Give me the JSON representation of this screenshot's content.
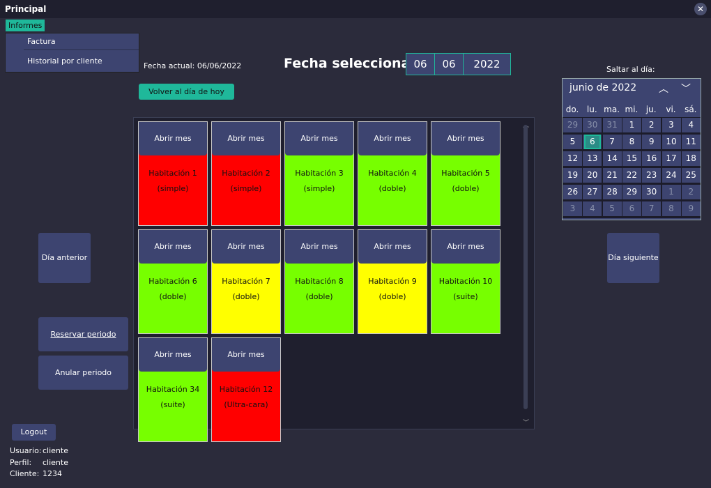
{
  "window": {
    "title": "Principal",
    "close_icon": "close-icon"
  },
  "menu": {
    "informes": "Informes",
    "items": [
      "Factura",
      "Historial por cliente"
    ]
  },
  "header": {
    "fecha_actual": "Fecha actual: 06/06/2022",
    "fecha_seleccionada_label": "Fecha seleccionada:",
    "day": "06",
    "month": "06",
    "year": "2022",
    "volver": "Volver al día de hoy",
    "saltar": "Saltar al día:"
  },
  "buttons": {
    "dia_anterior": "Día anterior",
    "dia_siguiente": "Día siguiente",
    "reservar": "Reservar periodo",
    "anular": "Anular periodo",
    "logout": "Logout"
  },
  "rooms": [
    {
      "btn": "Abrir mes",
      "name": "Habitación 1",
      "type": "(simple)",
      "color": "#ff0000"
    },
    {
      "btn": "Abrir mes",
      "name": "Habitación 2",
      "type": "(simple)",
      "color": "#ff0000"
    },
    {
      "btn": "Abrir mes",
      "name": "Habitación 3",
      "type": "(simple)",
      "color": "#77ff00"
    },
    {
      "btn": "Abrir mes",
      "name": "Habitación 4",
      "type": "(doble)",
      "color": "#77ff00"
    },
    {
      "btn": "Abrir mes",
      "name": "Habitación 5",
      "type": "(doble)",
      "color": "#77ff00"
    },
    {
      "btn": "Abrir mes",
      "name": "Habitación 6",
      "type": "(doble)",
      "color": "#77ff00"
    },
    {
      "btn": "Abrir mes",
      "name": "Habitación 7",
      "type": "(doble)",
      "color": "#ffff00"
    },
    {
      "btn": "Abrir mes",
      "name": "Habitación 8",
      "type": "(doble)",
      "color": "#77ff00"
    },
    {
      "btn": "Abrir mes",
      "name": "Habitación 9",
      "type": "(doble)",
      "color": "#ffff00"
    },
    {
      "btn": "Abrir mes",
      "name": "Habitación 10",
      "type": "(suite)",
      "color": "#77ff00"
    },
    {
      "btn": "Abrir mes",
      "name": "Habitación 34",
      "type": "(suite)",
      "color": "#77ff00"
    },
    {
      "btn": "Abrir mes",
      "name": "Habitación 12",
      "type": "(Ultra-cara)",
      "color": "#ff0000"
    }
  ],
  "calendar": {
    "month_label": "junio de 2022",
    "weekdays": [
      "do.",
      "lu.",
      "ma.",
      "mi.",
      "ju.",
      "vi.",
      "sá."
    ],
    "weeks": [
      [
        "29",
        "30",
        "31",
        "1",
        "2",
        "3",
        "4"
      ],
      [
        "5",
        "6",
        "7",
        "8",
        "9",
        "10",
        "11"
      ],
      [
        "12",
        "13",
        "14",
        "15",
        "16",
        "17",
        "18"
      ],
      [
        "19",
        "20",
        "21",
        "22",
        "23",
        "24",
        "25"
      ],
      [
        "26",
        "27",
        "28",
        "29",
        "30",
        "1",
        "2"
      ],
      [
        "3",
        "4",
        "5",
        "6",
        "7",
        "8",
        "9"
      ]
    ],
    "other_month": [
      [
        0,
        0
      ],
      [
        0,
        1
      ],
      [
        0,
        2
      ],
      [
        4,
        5
      ],
      [
        4,
        6
      ],
      [
        5,
        0
      ],
      [
        5,
        1
      ],
      [
        5,
        2
      ],
      [
        5,
        3
      ],
      [
        5,
        4
      ],
      [
        5,
        5
      ],
      [
        5,
        6
      ]
    ],
    "selected": [
      1,
      1
    ]
  },
  "footer": {
    "usuario_label": "Usuario:",
    "usuario": "cliente",
    "perfil_label": "Perfil:",
    "perfil": "cliente",
    "cliente_label": "Cliente:",
    "cliente": "1234"
  }
}
